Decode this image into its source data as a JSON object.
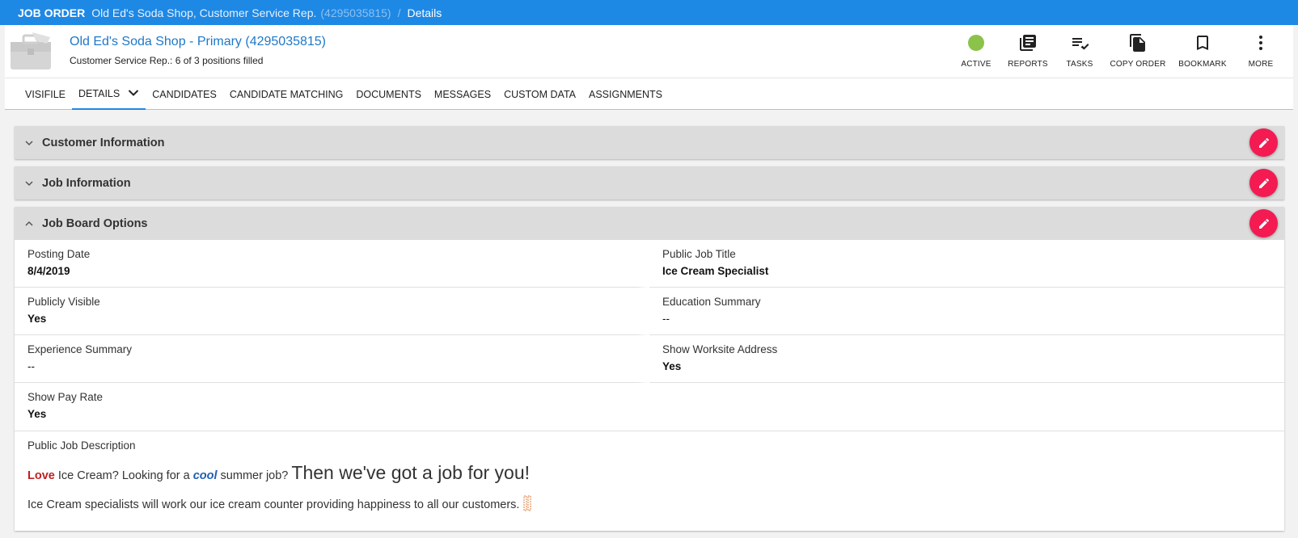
{
  "topbar": {
    "label": "JOB ORDER",
    "name": "Old Ed's Soda Shop, Customer Service Rep.",
    "id": "(4295035815)",
    "separator": "/",
    "current": "Details"
  },
  "header": {
    "company_link": "Old Ed's Soda Shop - Primary (4295035815)",
    "positions": "Customer Service Rep.: 6 of 3 positions filled",
    "status_color": "#8bc34a"
  },
  "actions": [
    {
      "label": "ACTIVE",
      "icon": "status-dot-icon"
    },
    {
      "label": "REPORTS",
      "icon": "reports-icon"
    },
    {
      "label": "TASKS",
      "icon": "tasks-icon"
    },
    {
      "label": "COPY ORDER",
      "icon": "copy-icon"
    },
    {
      "label": "BOOKMARK",
      "icon": "bookmark-icon"
    },
    {
      "label": "MORE",
      "icon": "more-vertical-icon"
    }
  ],
  "tabs": [
    {
      "label": "VISIFILE"
    },
    {
      "label": "DETAILS",
      "active": true
    },
    {
      "label": "CANDIDATES"
    },
    {
      "label": "CANDIDATE MATCHING"
    },
    {
      "label": "DOCUMENTS"
    },
    {
      "label": "MESSAGES"
    },
    {
      "label": "CUSTOM DATA"
    },
    {
      "label": "ASSIGNMENTS"
    }
  ],
  "panels": {
    "customer": {
      "title": "Customer Information",
      "expanded": false
    },
    "job": {
      "title": "Job Information",
      "expanded": false
    },
    "board": {
      "title": "Job Board Options",
      "expanded": true
    }
  },
  "fields": {
    "posting_date": {
      "label": "Posting Date",
      "value": "8/4/2019"
    },
    "public_job_title": {
      "label": "Public Job Title",
      "value": "Ice Cream Specialist"
    },
    "publicly_visible": {
      "label": "Publicly Visible",
      "value": "Yes"
    },
    "education_summary": {
      "label": "Education Summary",
      "value": "--"
    },
    "experience_summary": {
      "label": "Experience Summary",
      "value": "--"
    },
    "show_worksite_address": {
      "label": "Show Worksite Address",
      "value": "Yes"
    },
    "show_pay_rate": {
      "label": "Show Pay Rate",
      "value": "Yes"
    }
  },
  "description": {
    "label": "Public Job Description",
    "love": "Love",
    "part1": " Ice Cream? Looking for a ",
    "cool": "cool",
    "part2": " summer job? ",
    "big": "Then we've got a job for you!",
    "line2": "Ice Cream specialists will work our ice cream counter providing happiness to all our customers.",
    "emoji_icon": "ice-cream-icon"
  },
  "colors": {
    "topbar": "#1e88e5",
    "link": "#1e78c8",
    "edit_button": "#f31b52"
  }
}
